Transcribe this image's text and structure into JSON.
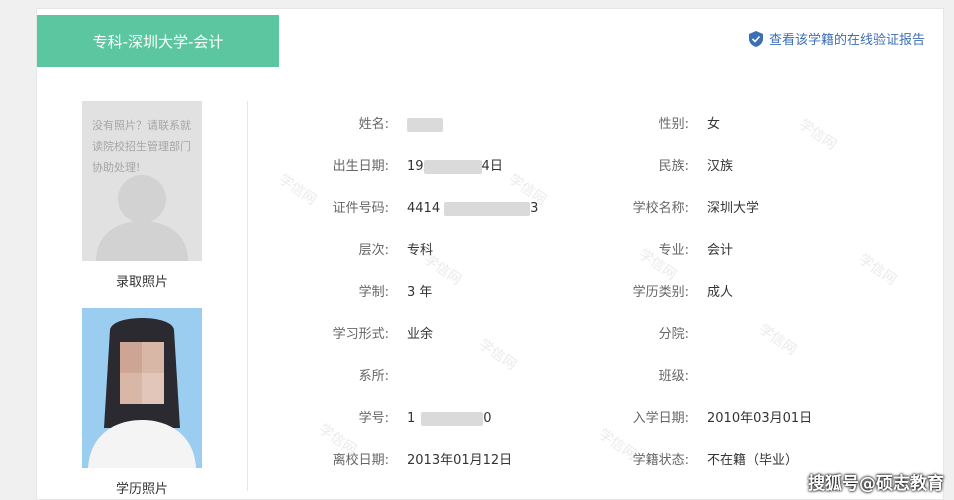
{
  "header": {
    "tab_title": "专科-深圳大学-会计",
    "report_link": "查看该学籍的在线验证报告"
  },
  "photos": {
    "no_photo_text": "没有照片？请联系就读院校招生管理部门协助处理!",
    "admission_photo_label": "录取照片",
    "diploma_photo_label": "学历照片"
  },
  "fields_left": [
    {
      "label": "姓名:",
      "value": ""
    },
    {
      "label": "出生日期:",
      "value": "19",
      "suffix": "4日"
    },
    {
      "label": "证件号码:",
      "value": "4414",
      "suffix": "3"
    },
    {
      "label": "层次:",
      "value": "专科"
    },
    {
      "label": "学制:",
      "value": "3 年"
    },
    {
      "label": "学习形式:",
      "value": "业余"
    },
    {
      "label": "系所:",
      "value": ""
    },
    {
      "label": "学号:",
      "value": "1",
      "suffix": "0"
    },
    {
      "label": "离校日期:",
      "value": "2013年01月12日"
    }
  ],
  "fields_right": [
    {
      "label": "性别:",
      "value": "女"
    },
    {
      "label": "民族:",
      "value": "汉族"
    },
    {
      "label": "学校名称:",
      "value": "深圳大学"
    },
    {
      "label": "专业:",
      "value": "会计"
    },
    {
      "label": "学历类别:",
      "value": "成人"
    },
    {
      "label": "分院:",
      "value": ""
    },
    {
      "label": "班级:",
      "value": ""
    },
    {
      "label": "入学日期:",
      "value": "2010年03月01日"
    },
    {
      "label": "学籍状态:",
      "value": "不在籍（毕业）"
    }
  ],
  "watermark_text": "学信网",
  "credit": "搜狐号@硕志教育",
  "colors": {
    "accent": "#5cc6a0",
    "link": "#3d6fb5"
  }
}
